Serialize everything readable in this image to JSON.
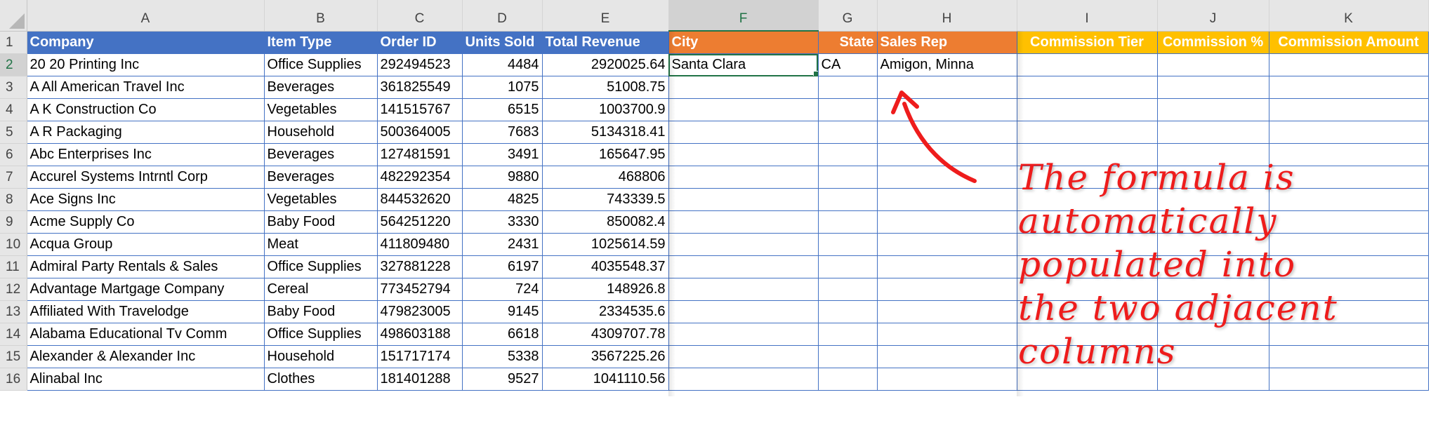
{
  "columns": [
    "A",
    "B",
    "C",
    "D",
    "E",
    "F",
    "G",
    "H",
    "I",
    "J",
    "K"
  ],
  "selected_column": "F",
  "header_row": {
    "row_number": "1",
    "company": "Company",
    "item_type": "Item Type",
    "order_id": "Order ID",
    "units_sold": "Units Sold",
    "total_revenue": "Total Revenue",
    "city": "City",
    "state": "State",
    "sales_rep": "Sales Rep",
    "commission_tier": "Commission Tier",
    "commission_pct": "Commission %",
    "commission_amount": "Commission Amount"
  },
  "rows": [
    {
      "n": "2",
      "company": "20 20 Printing Inc",
      "item_type": "Office Supplies",
      "order_id": "292494523",
      "units": "4484",
      "revenue": "2920025.64",
      "city": "Santa Clara",
      "state": "CA",
      "rep": "Amigon, Minna"
    },
    {
      "n": "3",
      "company": "A All American Travel Inc",
      "item_type": "Beverages",
      "order_id": "361825549",
      "units": "1075",
      "revenue": "51008.75",
      "city": "",
      "state": "",
      "rep": ""
    },
    {
      "n": "4",
      "company": "A K Construction Co",
      "item_type": "Vegetables",
      "order_id": "141515767",
      "units": "6515",
      "revenue": "1003700.9",
      "city": "",
      "state": "",
      "rep": ""
    },
    {
      "n": "5",
      "company": "A R Packaging",
      "item_type": "Household",
      "order_id": "500364005",
      "units": "7683",
      "revenue": "5134318.41",
      "city": "",
      "state": "",
      "rep": ""
    },
    {
      "n": "6",
      "company": "Abc Enterprises Inc",
      "item_type": "Beverages",
      "order_id": "127481591",
      "units": "3491",
      "revenue": "165647.95",
      "city": "",
      "state": "",
      "rep": ""
    },
    {
      "n": "7",
      "company": "Accurel Systems Intrntl Corp",
      "item_type": "Beverages",
      "order_id": "482292354",
      "units": "9880",
      "revenue": "468806",
      "city": "",
      "state": "",
      "rep": ""
    },
    {
      "n": "8",
      "company": "Ace Signs Inc",
      "item_type": "Vegetables",
      "order_id": "844532620",
      "units": "4825",
      "revenue": "743339.5",
      "city": "",
      "state": "",
      "rep": ""
    },
    {
      "n": "9",
      "company": "Acme Supply Co",
      "item_type": "Baby Food",
      "order_id": "564251220",
      "units": "3330",
      "revenue": "850082.4",
      "city": "",
      "state": "",
      "rep": ""
    },
    {
      "n": "10",
      "company": "Acqua Group",
      "item_type": "Meat",
      "order_id": "411809480",
      "units": "2431",
      "revenue": "1025614.59",
      "city": "",
      "state": "",
      "rep": ""
    },
    {
      "n": "11",
      "company": "Admiral Party Rentals & Sales",
      "item_type": "Office Supplies",
      "order_id": "327881228",
      "units": "6197",
      "revenue": "4035548.37",
      "city": "",
      "state": "",
      "rep": ""
    },
    {
      "n": "12",
      "company": "Advantage Martgage Company",
      "item_type": "Cereal",
      "order_id": "773452794",
      "units": "724",
      "revenue": "148926.8",
      "city": "",
      "state": "",
      "rep": ""
    },
    {
      "n": "13",
      "company": "Affiliated With Travelodge",
      "item_type": "Baby Food",
      "order_id": "479823005",
      "units": "9145",
      "revenue": "2334535.6",
      "city": "",
      "state": "",
      "rep": ""
    },
    {
      "n": "14",
      "company": "Alabama Educational Tv Comm",
      "item_type": "Office Supplies",
      "order_id": "498603188",
      "units": "6618",
      "revenue": "4309707.78",
      "city": "",
      "state": "",
      "rep": ""
    },
    {
      "n": "15",
      "company": "Alexander & Alexander Inc",
      "item_type": "Household",
      "order_id": "151717174",
      "units": "5338",
      "revenue": "3567225.26",
      "city": "",
      "state": "",
      "rep": ""
    },
    {
      "n": "16",
      "company": "Alinabal Inc",
      "item_type": "Clothes",
      "order_id": "181401288",
      "units": "9527",
      "revenue": "1041110.56",
      "city": "",
      "state": "",
      "rep": ""
    }
  ],
  "annotation": {
    "lines": [
      "The formula is",
      "automatically",
      "populated into",
      "the two adjacent",
      "columns"
    ],
    "color": "#ee1c1c"
  },
  "colors": {
    "header_blue": "#4472c4",
    "header_orange": "#ed7d31",
    "header_gold": "#ffc000",
    "selection_green": "#217346"
  }
}
